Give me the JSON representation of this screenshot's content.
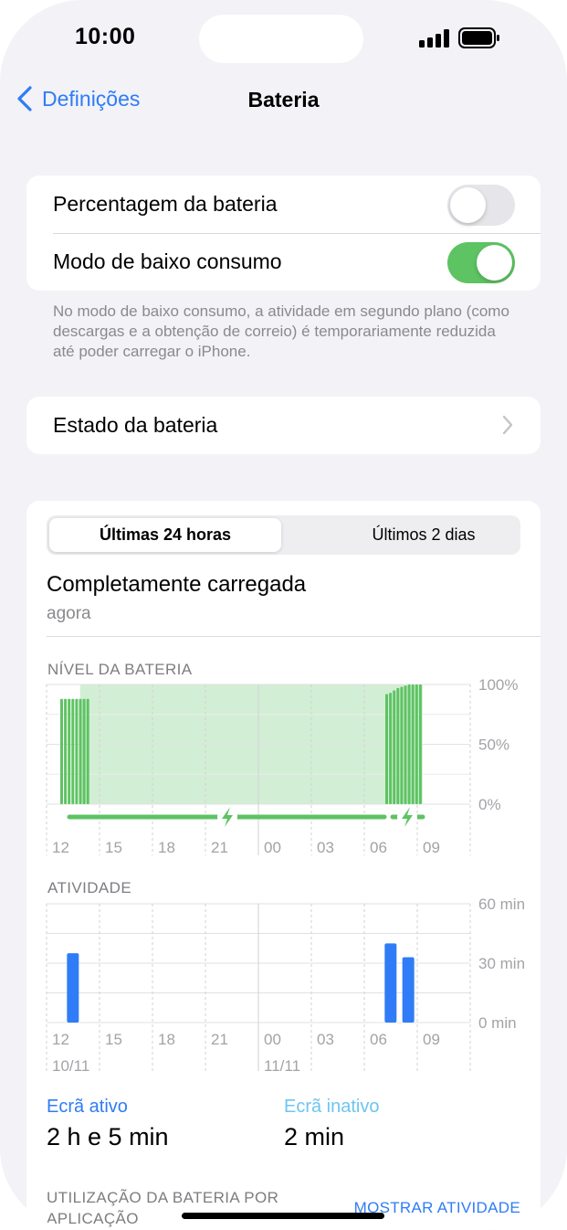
{
  "status_bar": {
    "time": "10:00"
  },
  "nav": {
    "back_label": "Definições",
    "title": "Bateria"
  },
  "toggles": {
    "percentage_label": "Percentagem da bateria",
    "percentage_on": false,
    "low_power_label": "Modo de baixo consumo",
    "low_power_on": true
  },
  "low_power_note": "No modo de baixo consumo, a atividade em segundo plano (como descargas e a obtenção de correio) é temporariamente reduzida até poder carregar o iPhone.",
  "battery_health": {
    "label": "Estado da bateria"
  },
  "segmented": {
    "options": [
      "Últimas 24 horas",
      "Últimos 2 dias"
    ],
    "selected": 0
  },
  "charge_state": {
    "title": "Completamente carregada",
    "subtitle": "agora"
  },
  "colors": {
    "accent": "#2f7cf6",
    "green": "#5ec363",
    "bar_blue": "#2f7cf6",
    "screen_off": "#6ec5f0"
  },
  "chart_data": [
    {
      "type": "bar",
      "title": "NÍVEL DA BATERIA",
      "x_ticks": [
        "12",
        "15",
        "18",
        "21",
        "00",
        "03",
        "06",
        "09"
      ],
      "y_ticks": [
        "100%",
        "50%",
        "0%"
      ],
      "ylim": [
        0,
        100
      ],
      "charging_segments": [
        [
          0.2,
          21.5
        ],
        [
          21.5,
          23.5
        ]
      ],
      "series": [
        {
          "values_12_to_14": [
            88,
            88,
            88,
            88,
            88,
            88,
            88,
            88
          ]
        },
        {
          "values_06_to_09": [
            92,
            93,
            95,
            97,
            98,
            99,
            100,
            100,
            100,
            100
          ]
        }
      ]
    },
    {
      "type": "bar",
      "title": "ATIVIDADE",
      "x_ticks": [
        "12",
        "15",
        "18",
        "21",
        "00",
        "03",
        "06",
        "09"
      ],
      "date_labels": [
        "10/11",
        "11/11"
      ],
      "y_ticks": [
        "60 min",
        "30 min",
        "0 min"
      ],
      "ylim": [
        0,
        60
      ],
      "bars": [
        {
          "hour_index": 1,
          "minutes": 35
        },
        {
          "hour_index": 19,
          "minutes": 40
        },
        {
          "hour_index": 20,
          "minutes": 33
        }
      ]
    }
  ],
  "legend": {
    "screen_on_label": "Ecrã ativo",
    "screen_on_value": "2 h e 5 min",
    "screen_off_label": "Ecrã inativo",
    "screen_off_value": "2 min"
  },
  "usage_section": {
    "title": "UTILIZAÇÃO DA BATERIA POR APLICAÇÃO",
    "show_activity": "MOSTRAR ATIVIDADE"
  }
}
